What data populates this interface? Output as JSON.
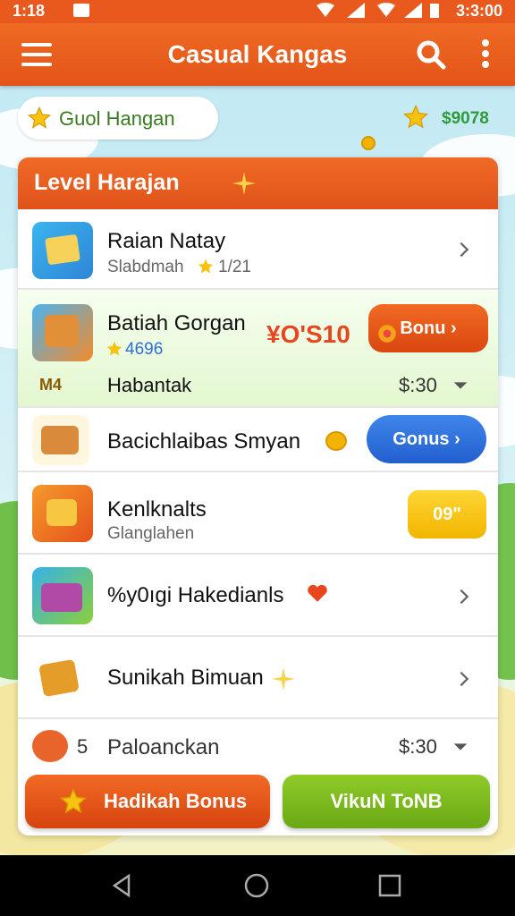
{
  "status_bar": {
    "time": "1:18",
    "right_time": "3:3:00"
  },
  "app_bar": {
    "title": "Casual Kangas"
  },
  "profile": {
    "name": "Guol Hangan",
    "coins": "$9078"
  },
  "card": {
    "header": "Level Harajan",
    "rows": [
      {
        "label": "Raian Natay",
        "sub": "Slabdmah",
        "meta": "1/21"
      },
      {
        "label": "Batiah Gorgan",
        "sub": "4696",
        "price": "¥O'S10",
        "button": "Bonu",
        "sub2_label": "Habantak",
        "sub2_value": "$:30",
        "sub2_icon": "M4"
      },
      {
        "label": "Bacichlaibas Smyan",
        "button": "Gonus"
      },
      {
        "label": "Kenlknalts",
        "sub": "Glanglahen",
        "button": "09\""
      },
      {
        "label": "%y0ıgi Hakedianls"
      },
      {
        "label": "Sunikah Bimuan"
      },
      {
        "label": "Paloanckan",
        "value": "$:30",
        "prefix": "5"
      }
    ]
  },
  "bottom": {
    "left_label": "Hadikah Bonus",
    "right_label": "VikuN ToNB"
  },
  "colors": {
    "primary": "#e9581c",
    "green": "#7ab51d",
    "blue": "#2f6ed8",
    "yellow": "#f7c510"
  },
  "icons": [
    "menu-icon",
    "search-icon",
    "more-icon",
    "star-icon",
    "chevron-right-icon",
    "chevron-down-icon",
    "back-icon",
    "home-icon",
    "recents-icon"
  ]
}
